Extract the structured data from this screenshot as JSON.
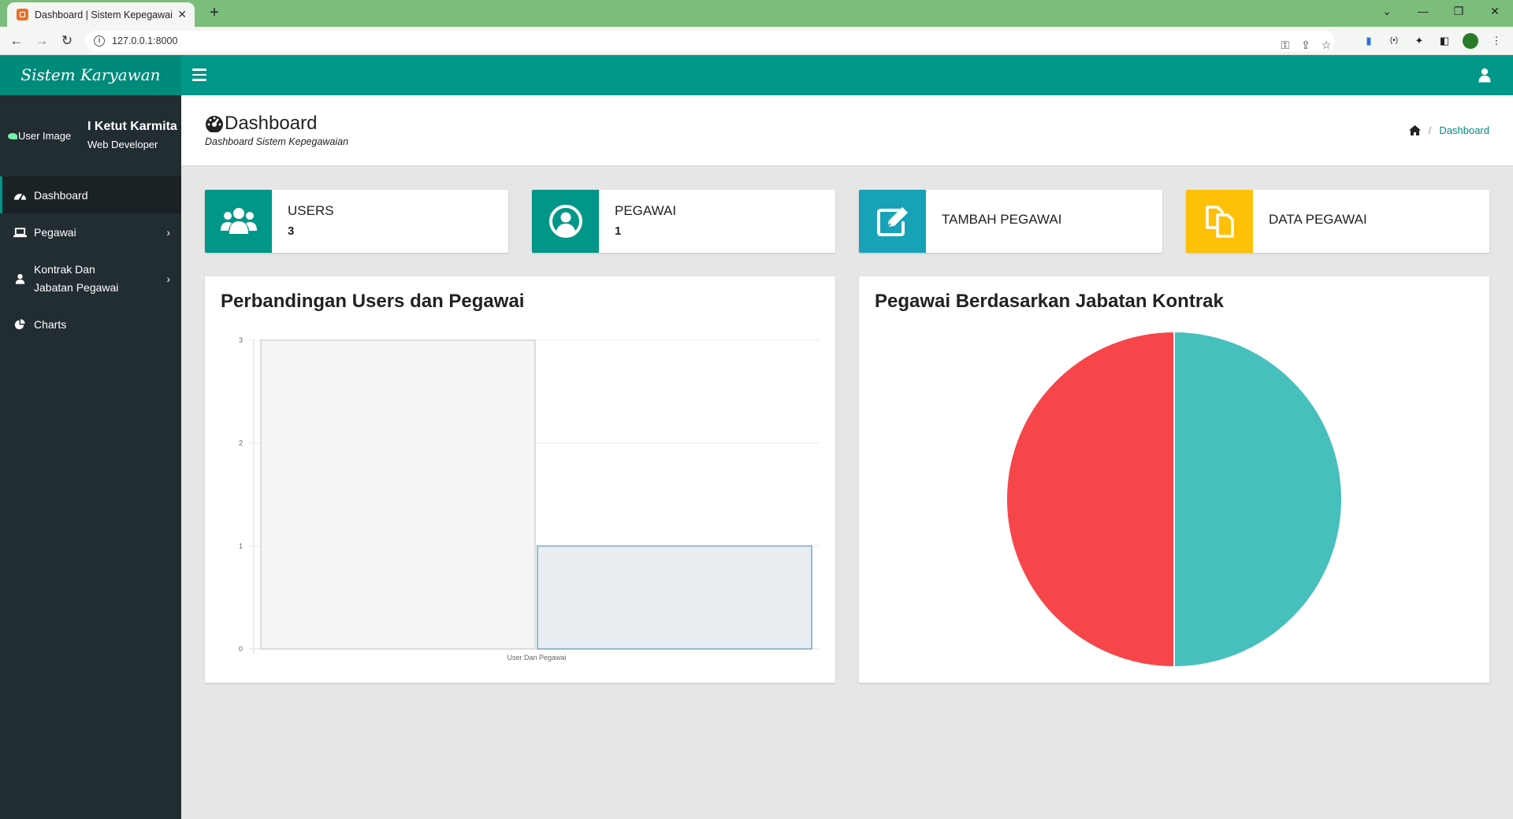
{
  "browser": {
    "tab_title": "Dashboard | Sistem Kepegawaian",
    "url": "127.0.0.1:8000"
  },
  "app": {
    "brand": "Sistem Karyawan"
  },
  "user": {
    "image_alt": "User Image",
    "name": "I Ketut Karmita",
    "role": "Web Developer"
  },
  "sidebar": {
    "items": [
      {
        "label": "Dashboard",
        "icon": "dashboard-icon",
        "active": true
      },
      {
        "label": "Pegawai",
        "icon": "laptop-icon",
        "has_children": true
      },
      {
        "label_line1": "Kontrak Dan",
        "label_line2": "Jabatan Pegawai",
        "icon": "user-icon",
        "has_children": true
      },
      {
        "label": "Charts",
        "icon": "pie-chart-icon"
      }
    ]
  },
  "header": {
    "title": "Dashboard",
    "subtitle": "Dashboard Sistem Kepegawaian",
    "breadcrumb": "Dashboard"
  },
  "infoboxes": [
    {
      "label": "USERS",
      "value": "3",
      "color": "#009688",
      "icon": "users-icon"
    },
    {
      "label": "PEGAWAI",
      "value": "1",
      "color": "#009688",
      "icon": "user-circle-icon"
    },
    {
      "label": "TAMBAH PEGAWAI",
      "color": "#17a2b8",
      "icon": "edit-icon"
    },
    {
      "label": "DATA PEGAWAI",
      "color": "#ffc107",
      "icon": "copy-icon"
    }
  ],
  "chart_data": [
    {
      "type": "bar",
      "title": "Perbandingan Users dan Pegawai",
      "categories": [
        "User Dan Pegawai"
      ],
      "series": [
        {
          "values": [
            3
          ],
          "color": "#f5f5f5",
          "stroke": "#dcdcdc"
        },
        {
          "values": [
            1
          ],
          "color": "#e8eef2",
          "stroke": "#97bbcd"
        }
      ],
      "yticks": [
        "0",
        "1",
        "2",
        "3"
      ],
      "ylim": [
        0,
        3
      ],
      "grid": true
    },
    {
      "type": "pie",
      "title": "Pegawai Berdasarkan Jabatan Kontrak",
      "values": [
        1,
        1
      ],
      "colors": [
        "#46bfbd",
        "#f7464a"
      ]
    }
  ]
}
